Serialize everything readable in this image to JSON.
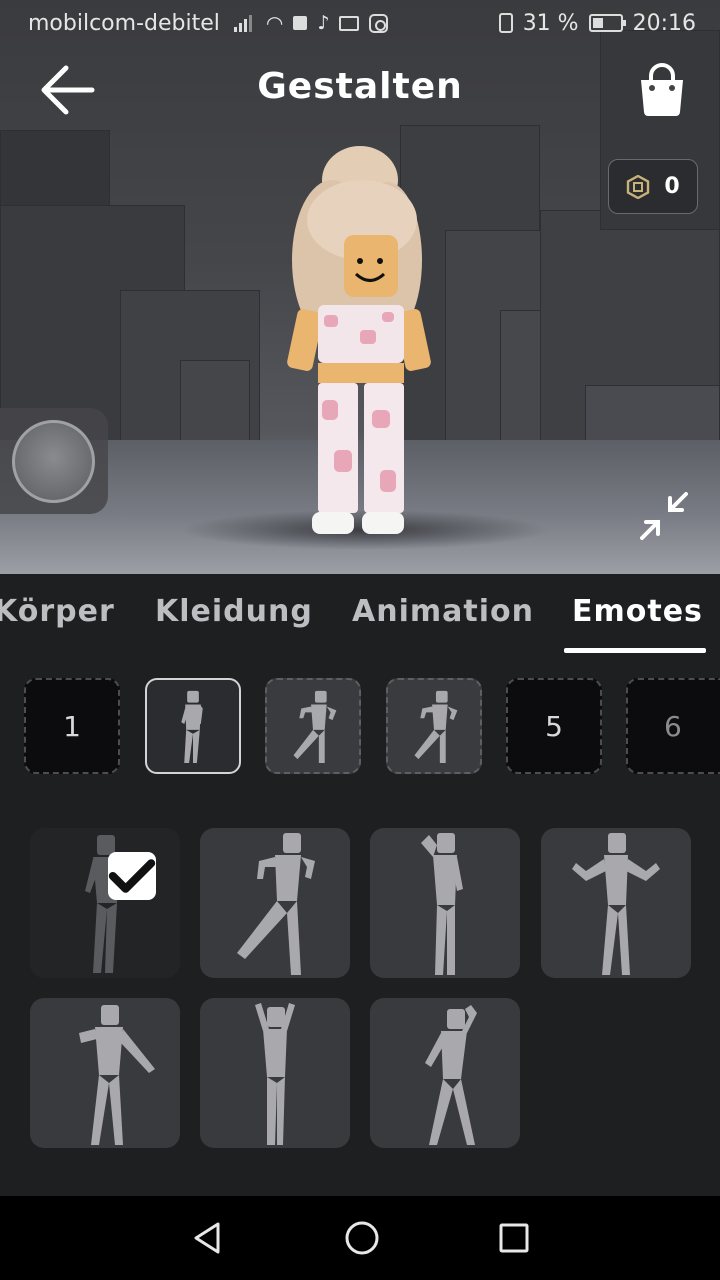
{
  "status_bar": {
    "carrier": "mobilcom-debitel",
    "battery": "31 %",
    "time": "20:16"
  },
  "header": {
    "title": "Gestalten",
    "back_icon": "arrow-left-icon",
    "shop_icon": "shopping-bag-icon"
  },
  "currency": {
    "icon": "robux-icon",
    "amount": "0"
  },
  "tabs": [
    {
      "label": "Körper"
    },
    {
      "label": "Kleidung"
    },
    {
      "label": "Animation"
    },
    {
      "label": "Emotes",
      "active": true
    }
  ],
  "emote_slots": [
    {
      "label": "1",
      "state": "empty"
    },
    {
      "label": "",
      "state": "selected"
    },
    {
      "label": "",
      "state": "filled"
    },
    {
      "label": "",
      "state": "filled"
    },
    {
      "label": "5",
      "state": "empty"
    },
    {
      "label": "6",
      "state": "empty"
    }
  ],
  "emotes": [
    {
      "pose": "idle",
      "equipped": true
    },
    {
      "pose": "dance-kick"
    },
    {
      "pose": "salute"
    },
    {
      "pose": "shrug"
    },
    {
      "pose": "point"
    },
    {
      "pose": "hands-up"
    },
    {
      "pose": "wave-lean"
    }
  ],
  "colors": {
    "panel_bg": "#1e1f21",
    "tile_bg": "#393a3e",
    "figure": "#a9a9ad",
    "active_tab": "#ffffff"
  }
}
